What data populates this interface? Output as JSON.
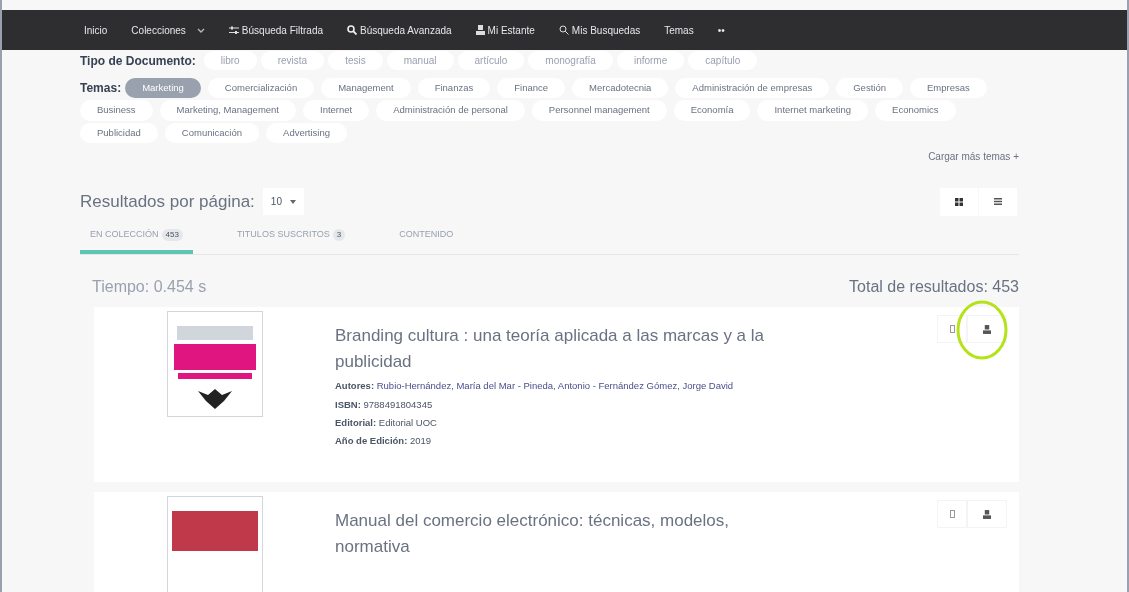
{
  "nav": [
    {
      "label": "Inicio",
      "kind": "plain"
    },
    {
      "label": "Colecciones",
      "kind": "dropdown"
    },
    {
      "label": "Búsqueda Filtrada",
      "kind": "filter"
    },
    {
      "label": "Búsqueda Avanzada",
      "kind": "search"
    },
    {
      "label": "Mi Estante",
      "kind": "shelf"
    },
    {
      "label": "Mis Busquedas",
      "kind": "saved"
    },
    {
      "label": "Temas",
      "kind": "plain"
    },
    {
      "label": "••",
      "kind": "plain"
    }
  ],
  "document_types": {
    "label": "Tipo de Documento:",
    "items": [
      "libro",
      "revista",
      "tesis",
      "manual",
      "artículo",
      "monografía",
      "informe",
      "capítulo"
    ]
  },
  "topics": {
    "label": "Temas:",
    "items": [
      {
        "label": "Marketing",
        "selected": true
      },
      {
        "label": "Comercialización",
        "selected": false
      },
      {
        "label": "Management",
        "selected": false
      },
      {
        "label": "Finanzas",
        "selected": false
      },
      {
        "label": "Finance",
        "selected": false
      },
      {
        "label": "Mercadotecnia",
        "selected": false
      },
      {
        "label": "Administración de empresas",
        "selected": false
      },
      {
        "label": "Gestión",
        "selected": false
      },
      {
        "label": "Empresas",
        "selected": false
      },
      {
        "label": "Business",
        "selected": false
      },
      {
        "label": "Marketing, Management",
        "selected": false
      },
      {
        "label": "Internet",
        "selected": false
      },
      {
        "label": "Administración de personal",
        "selected": false
      },
      {
        "label": "Personnel management",
        "selected": false
      },
      {
        "label": "Economía",
        "selected": false
      },
      {
        "label": "Internet marketing",
        "selected": false
      },
      {
        "label": "Economics",
        "selected": false
      },
      {
        "label": "Publicidad",
        "selected": false
      },
      {
        "label": "Comunicación",
        "selected": false
      },
      {
        "label": "Advertising",
        "selected": false
      }
    ],
    "more": "Cargar más temas +"
  },
  "per_page": {
    "label": "Resultados por página:",
    "value": "10"
  },
  "tabs": [
    {
      "label": "EN COLECCIÓN",
      "count": "453",
      "selected": true
    },
    {
      "label": "TITULOS SUSCRITOS",
      "count": "3",
      "selected": false
    },
    {
      "label": "CONTENIDO",
      "selected": false
    }
  ],
  "time": "Tiempo: 0.454 s",
  "total": "Total de resultados: 453",
  "results": [
    {
      "title": "Branding cultura : una teoría aplicada a las marcas y a la publicidad",
      "fields": [
        {
          "label": "Autores:",
          "value": "Rubio-Hernández, María del Mar - Pineda, Antonio - Fernández Gómez, Jorge David"
        },
        {
          "label": "ISBN:",
          "value": "9788491804345"
        },
        {
          "label": "Editorial:",
          "value": "Editorial UOC"
        },
        {
          "label": "Año de Edición:",
          "value": "2019"
        }
      ],
      "highlighted": true
    },
    {
      "title": "Manual del comercio electrónico: técnicas, modelos, normativa",
      "highlighted": false
    }
  ]
}
